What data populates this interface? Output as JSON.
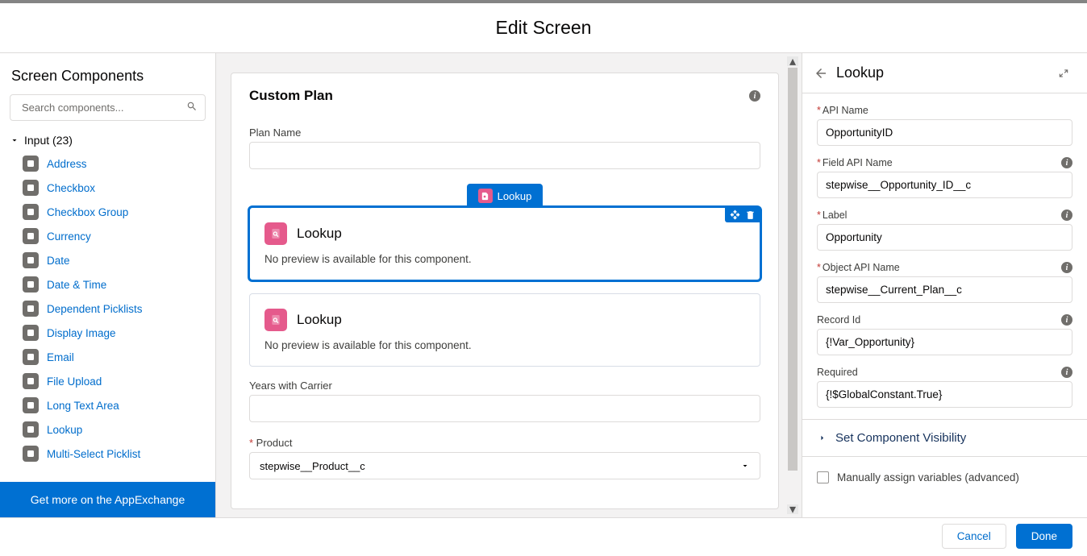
{
  "title": "Edit Screen",
  "left": {
    "header": "Screen Components",
    "search_placeholder": "Search components...",
    "category_label": "Input (23)",
    "items": [
      "Address",
      "Checkbox",
      "Checkbox Group",
      "Currency",
      "Date",
      "Date & Time",
      "Dependent Picklists",
      "Display Image",
      "Email",
      "File Upload",
      "Long Text Area",
      "Lookup",
      "Multi-Select Picklist"
    ],
    "appexchange": "Get more on the AppExchange"
  },
  "center": {
    "card_title": "Custom Plan",
    "plan_name_label": "Plan Name",
    "pill_label": "Lookup",
    "lookup_title": "Lookup",
    "no_preview": "No preview is available for this component.",
    "years_label": "Years with Carrier",
    "product_label": "Product",
    "product_value": "stepwise__Product__c"
  },
  "right": {
    "title": "Lookup",
    "props": [
      {
        "label": "API Name",
        "required": true,
        "info": false,
        "value": "OpportunityID"
      },
      {
        "label": "Field API Name",
        "required": true,
        "info": true,
        "value": "stepwise__Opportunity_ID__c"
      },
      {
        "label": "Label",
        "required": true,
        "info": true,
        "value": "Opportunity"
      },
      {
        "label": "Object API Name",
        "required": true,
        "info": true,
        "value": "stepwise__Current_Plan__c"
      },
      {
        "label": "Record Id",
        "required": false,
        "info": true,
        "value": "{!Var_Opportunity}"
      },
      {
        "label": "Required",
        "required": false,
        "info": true,
        "value": "{!$GlobalConstant.True}"
      }
    ],
    "visibility": "Set Component Visibility",
    "manual": "Manually assign variables (advanced)"
  },
  "footer": {
    "cancel": "Cancel",
    "done": "Done"
  }
}
